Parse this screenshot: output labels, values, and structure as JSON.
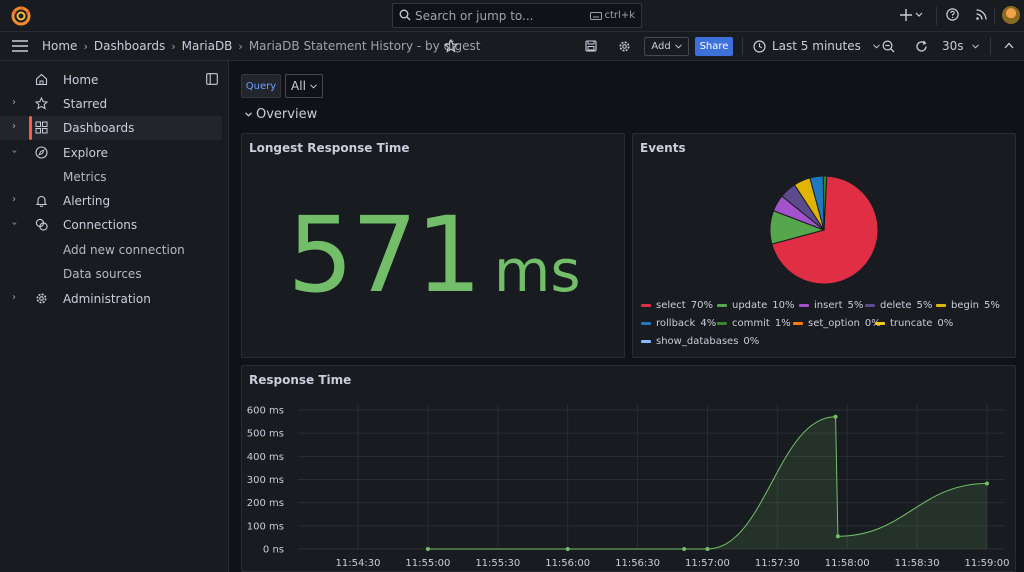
{
  "topbar": {
    "search_placeholder": "Search or jump to...",
    "search_shortcut": "ctrl+k",
    "icons": [
      "grafana-logo",
      "search-icon",
      "keyboard-icon",
      "plus-icon",
      "help-icon",
      "news-icon",
      "avatar"
    ]
  },
  "breadcrumb": {
    "items": [
      "Home",
      "Dashboards",
      "MariaDB",
      "MariaDB Statement History - by digest"
    ]
  },
  "toolbar": {
    "add_label": "Add",
    "share_label": "Share",
    "time_range": "Last 5 minutes",
    "refresh_interval": "30s"
  },
  "sidebar": {
    "items": [
      {
        "label": "Home",
        "icon": "home-icon"
      },
      {
        "label": "Starred",
        "icon": "star-icon"
      },
      {
        "label": "Dashboards",
        "icon": "dashboards-icon",
        "active": true
      },
      {
        "label": "Explore",
        "icon": "compass-icon"
      },
      {
        "label": "Metrics"
      },
      {
        "label": "Alerting",
        "icon": "bell-icon"
      },
      {
        "label": "Connections",
        "icon": "connections-icon"
      },
      {
        "label": "Add new connection"
      },
      {
        "label": "Data sources"
      },
      {
        "label": "Administration",
        "icon": "gear-icon"
      }
    ]
  },
  "variables": {
    "query_label": "Query",
    "query_value": "All"
  },
  "row": {
    "title": "Overview"
  },
  "panels": {
    "stat": {
      "title": "Longest Response Time",
      "value": "571",
      "unit": "ms"
    },
    "events": {
      "title": "Events"
    },
    "response": {
      "title": "Response Time"
    }
  },
  "colors": {
    "accent_green": "#73bf69",
    "red": "#e02f44",
    "purple": "#8f3bb8",
    "yellow": "#fade2a",
    "blue": "#5794f2",
    "orange": "#ff780a",
    "share_blue": "#3d71d9"
  },
  "chart_data": [
    {
      "type": "pie",
      "title": "Events",
      "legend_position": "bottom",
      "slices": [
        {
          "name": "select",
          "pct_label": "70%",
          "value": 70,
          "color": "#e02f44"
        },
        {
          "name": "update",
          "pct_label": "10%",
          "value": 10,
          "color": "#56a64b"
        },
        {
          "name": "insert",
          "pct_label": "5%",
          "value": 5,
          "color": "#a352cc"
        },
        {
          "name": "delete",
          "pct_label": "5%",
          "value": 5,
          "color": "#5b4a8c"
        },
        {
          "name": "begin",
          "pct_label": "5%",
          "value": 5,
          "color": "#e0b400"
        },
        {
          "name": "rollback",
          "pct_label": "4%",
          "value": 4,
          "color": "#1f78c1"
        },
        {
          "name": "commit",
          "pct_label": "1%",
          "value": 1,
          "color": "#37872d"
        },
        {
          "name": "set_option",
          "pct_label": "0%",
          "value": 0,
          "color": "#ff780a"
        },
        {
          "name": "truncate",
          "pct_label": "0%",
          "value": 0,
          "color": "#f2cc0c"
        },
        {
          "name": "show_databases",
          "pct_label": "0%",
          "value": 0,
          "color": "#8ab8ff"
        }
      ]
    },
    {
      "type": "area",
      "title": "Response Time",
      "x_ticks": [
        "11:54:30",
        "11:55:00",
        "11:55:30",
        "11:56:00",
        "11:56:30",
        "11:57:00",
        "11:57:30",
        "11:58:00",
        "11:58:30",
        "11:59:00"
      ],
      "y_ticks": [
        "0 ns",
        "100 ms",
        "200 ms",
        "300 ms",
        "400 ms",
        "500 ms",
        "600 ms"
      ],
      "ylim": [
        0,
        600
      ],
      "grid": true,
      "series": [
        {
          "color": "#73bf69",
          "points": [
            {
              "x": "11:55:00",
              "y": 0
            },
            {
              "x": "11:56:00",
              "y": 0
            },
            {
              "x": "11:56:50",
              "y": 0
            },
            {
              "x": "11:57:00",
              "y": 0
            },
            {
              "x": "11:57:55",
              "y": 571
            },
            {
              "x": "11:57:56",
              "y": 55
            },
            {
              "x": "11:59:00",
              "y": 283
            }
          ]
        }
      ]
    }
  ]
}
